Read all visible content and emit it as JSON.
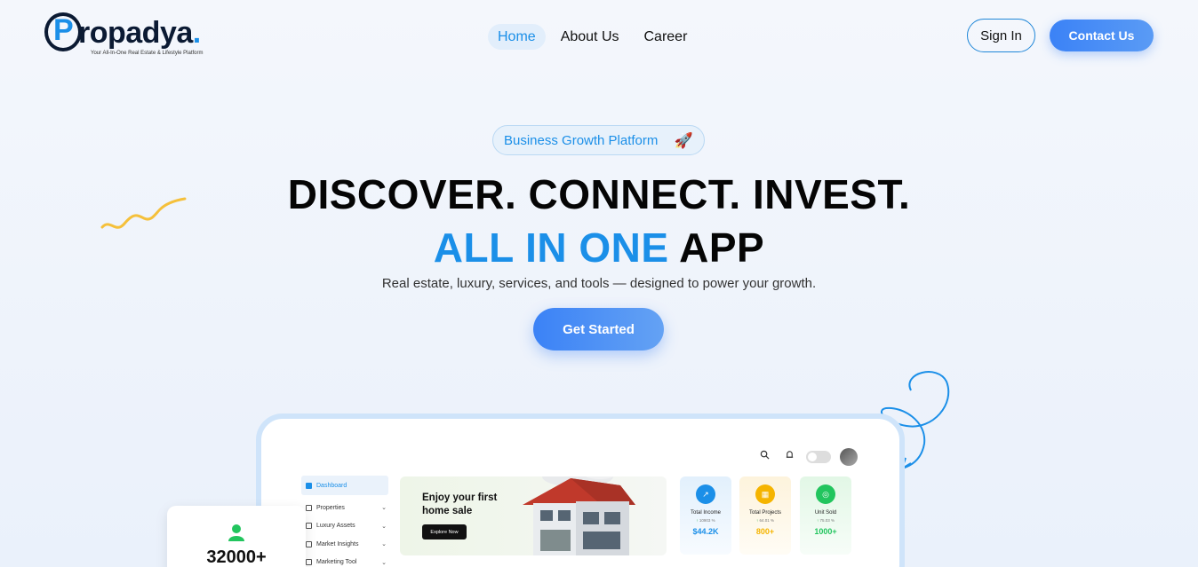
{
  "brand": {
    "logo_letter": "P",
    "name_rest": "ropadya",
    "name_dot": ".",
    "tagline": "Your All-In-One Real Estate & Lifestyle Platform",
    "accent": "#1b8fe8",
    "dark": "#0b1a33"
  },
  "nav": {
    "items": [
      {
        "label": "Home",
        "active": true
      },
      {
        "label": "About Us",
        "active": false
      },
      {
        "label": "Career",
        "active": false
      }
    ],
    "signin_label": "Sign In",
    "contact_label": "Contact Us"
  },
  "hero": {
    "badge_label": "Business Growth Platform",
    "badge_icon": "rocket-icon",
    "headline_line1": "DISCOVER. CONNECT. INVEST.",
    "headline_line2_highlight": "ALL IN ONE",
    "headline_line2_rest": " APP",
    "subtitle": "Real estate, luxury, services, and tools — designed to power your growth.",
    "cta_label": "Get Started"
  },
  "dashboard": {
    "sidebar": [
      {
        "label": "Dashboard",
        "active": true
      },
      {
        "label": "Properties",
        "active": false
      },
      {
        "label": "Luxury Assets",
        "active": false
      },
      {
        "label": "Market Insights",
        "active": false
      },
      {
        "label": "Marketing Tool",
        "active": false
      }
    ],
    "promo": {
      "title": "Enjoy your first home sale",
      "button_label": "Explore Now"
    },
    "stats": [
      {
        "label": "Total Income",
        "pct": "10903 %",
        "value": "$44.2K",
        "color": "#1b8fe8",
        "icon": "trend-up-icon"
      },
      {
        "label": "Total Projects",
        "pct": "64.01 %",
        "value": "800+",
        "color": "#f5b400",
        "icon": "building-icon"
      },
      {
        "label": "Unit Sold",
        "pct": "75.03 %",
        "value": "1000+",
        "color": "#22c55e",
        "icon": "target-icon"
      }
    ],
    "topbar_icons": [
      "search-icon",
      "bell-icon",
      "theme-toggle",
      "avatar"
    ]
  },
  "floating_card": {
    "count": "32000+",
    "icon": "user-icon",
    "icon_color": "#22c55e"
  }
}
